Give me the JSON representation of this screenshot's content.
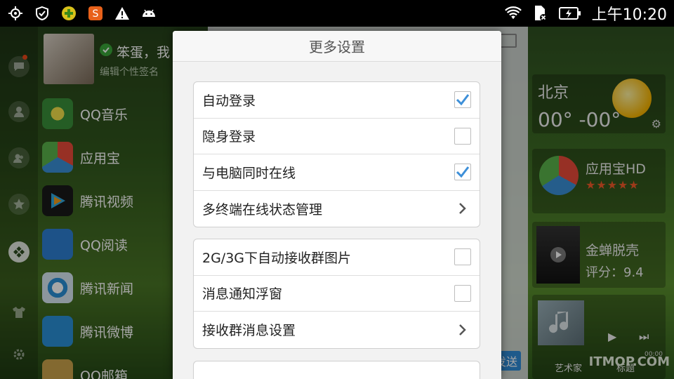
{
  "status_bar": {
    "clock": "上午10:20",
    "left_icons": [
      "gps-icon",
      "shield-icon",
      "plus-app-icon",
      "sogou-icon",
      "warning-icon",
      "android-icon"
    ],
    "right_icons": [
      "wifi-icon",
      "sd-card-icon",
      "battery-charging-icon"
    ]
  },
  "profile": {
    "nickname": "笨蛋，我",
    "signature": "编辑个性签名"
  },
  "apps": [
    {
      "name": "QQ音乐",
      "color": "#3a8f3a"
    },
    {
      "name": "应用宝",
      "color": "#e6e6e6"
    },
    {
      "name": "腾讯视频",
      "color": "#1a1a1a"
    },
    {
      "name": "QQ阅读",
      "color": "#2d7fd1"
    },
    {
      "name": "腾讯新闻",
      "color": "#d8e6f2"
    },
    {
      "name": "腾讯微博",
      "color": "#2a8fd6"
    },
    {
      "name": "QQ邮箱",
      "color": "#c9a14b"
    }
  ],
  "widgets": {
    "weather": {
      "city": "北京",
      "temp": "00° -00°"
    },
    "app_promo": {
      "name": "应用宝HD",
      "rating": "★★★★★"
    },
    "movie": {
      "title": "金蝉脱壳",
      "score": "评分：9.4"
    },
    "music": {
      "artist": "艺术家",
      "title": "标题",
      "time": "00:00"
    }
  },
  "send_button": "发送",
  "watermark": "ITMOP.COM",
  "dialog": {
    "title": "更多设置",
    "group1": [
      {
        "label": "自动登录",
        "type": "checkbox",
        "checked": true
      },
      {
        "label": "隐身登录",
        "type": "checkbox",
        "checked": false
      },
      {
        "label": "与电脑同时在线",
        "type": "checkbox",
        "checked": true
      },
      {
        "label": "多终端在线状态管理",
        "type": "link"
      }
    ],
    "group2": [
      {
        "label": "2G/3G下自动接收群图片",
        "type": "checkbox",
        "checked": false
      },
      {
        "label": "消息通知浮窗",
        "type": "checkbox",
        "checked": false
      },
      {
        "label": "接收群消息设置",
        "type": "link"
      }
    ]
  },
  "colors": {
    "check": "#3d8fd8",
    "accent_blue": "#2f8ad6"
  }
}
